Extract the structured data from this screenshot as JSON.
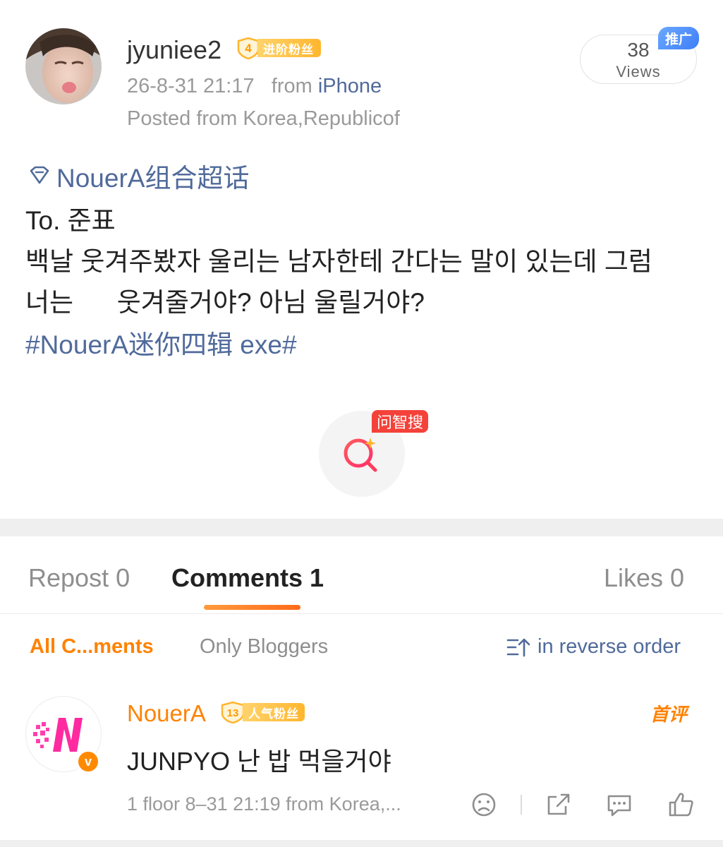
{
  "post": {
    "username": "jyuniee2",
    "fan_badge": {
      "level": "4",
      "label": "进阶粉丝"
    },
    "timestamp": "26-8-31 21:17",
    "from_prefix": "from",
    "source": "iPhone",
    "posted_from": "Posted from Korea,Republicof",
    "views": {
      "count": "38",
      "label": "Views",
      "promo_tag": "推广"
    },
    "supertopic": "NouerA组合超话",
    "body_lines": [
      "To. 준표",
      "백날 웃겨주봤자 울리는 남자한테 간다는 말이 있는데 그럼",
      "너는      웃겨줄거야? 아님 울릴거야?"
    ],
    "hashtag": "#NouerA迷你四辑 exe#",
    "search_tag": "问智搜"
  },
  "tabs": {
    "repost": "Repost 0",
    "comments": "Comments 1",
    "likes": "Likes 0"
  },
  "filters": {
    "all": "All C...ments",
    "bloggers": "Only Bloggers",
    "order": "in reverse order"
  },
  "comment": {
    "name": "NouerA",
    "badge": {
      "level": "13",
      "label": "人气粉丝"
    },
    "first_tag": "首评",
    "text": "JUNPYO 난 밥 먹을거야",
    "meta": "1 floor 8–31 21:19  from Korea,..."
  },
  "colors": {
    "link_blue": "#506a9b",
    "accent_orange": "#ff8200",
    "badge_gold": "#ffb62e",
    "promo_blue": "#3f7ef7",
    "search_red": "#f4423a"
  }
}
